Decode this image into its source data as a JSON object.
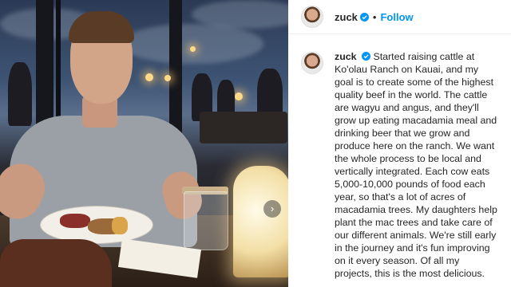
{
  "post": {
    "username": "zuck",
    "follow_label": "Follow",
    "separator": "•",
    "caption": "Started raising cattle at Ko'olau Ranch on Kauai, and my goal is to create some of the highest quality beef in the world. The cattle are wagyu and angus, and they'll grow up eating macadamia meal and drinking beer that we grow and produce here on the ranch. We want the whole process to be local and vertically integrated. Each cow eats 5,000-10,000 pounds of food each year, so that's a lot of acres of macadamia trees. My daughters help plant the mac trees and take care of our different animals. We're still early in the journey and it's fun improving on it every season. Of all my projects, this is the most delicious."
  },
  "icons": {
    "verified": "verified-badge-icon",
    "next": "chevron-right-icon"
  },
  "colors": {
    "accent": "#0095f6",
    "text": "#262626",
    "verified": "#0095f6"
  }
}
